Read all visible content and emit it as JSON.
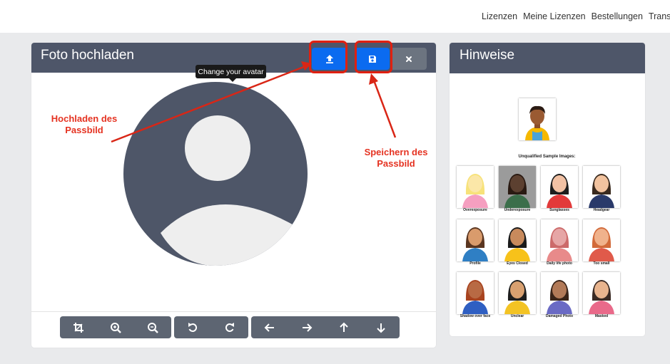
{
  "nav": {
    "items": [
      "Lizenzen",
      "Meine Lizenzen",
      "Bestellungen",
      "Transfer"
    ]
  },
  "upload_card": {
    "title": "Foto hochladen",
    "tooltip": "Change your avatar",
    "upload_icon": "upload-icon",
    "save_icon": "save-icon",
    "close_icon": "close-icon"
  },
  "annotations": {
    "upload": [
      "Hochladen des",
      "Passbild"
    ],
    "save": [
      "Speichern des",
      "Passbild"
    ]
  },
  "toolbar": {
    "groups": [
      [
        "crop-icon",
        "zoom-in-icon",
        "zoom-out-icon"
      ],
      [
        "rotate-left-icon",
        "rotate-right-icon"
      ],
      [
        "move-left-icon",
        "move-right-icon",
        "move-up-icon",
        "move-down-icon"
      ]
    ]
  },
  "hints": {
    "title": "Hinweise",
    "caption": "Unqualified Sample Images:",
    "samples": [
      "Overexposure",
      "Underexposure",
      "Sunglasses",
      "Headgear",
      "Profile",
      "Eyes Closed",
      "Daily life photo",
      "Too small",
      "Shadow over face",
      "Unclear",
      "Damaged Photo",
      "Masked"
    ]
  },
  "colors": {
    "header": "#4e5669",
    "primary": "#0b6bf0",
    "highlight": "#e02010",
    "annotation": "#e53322"
  }
}
